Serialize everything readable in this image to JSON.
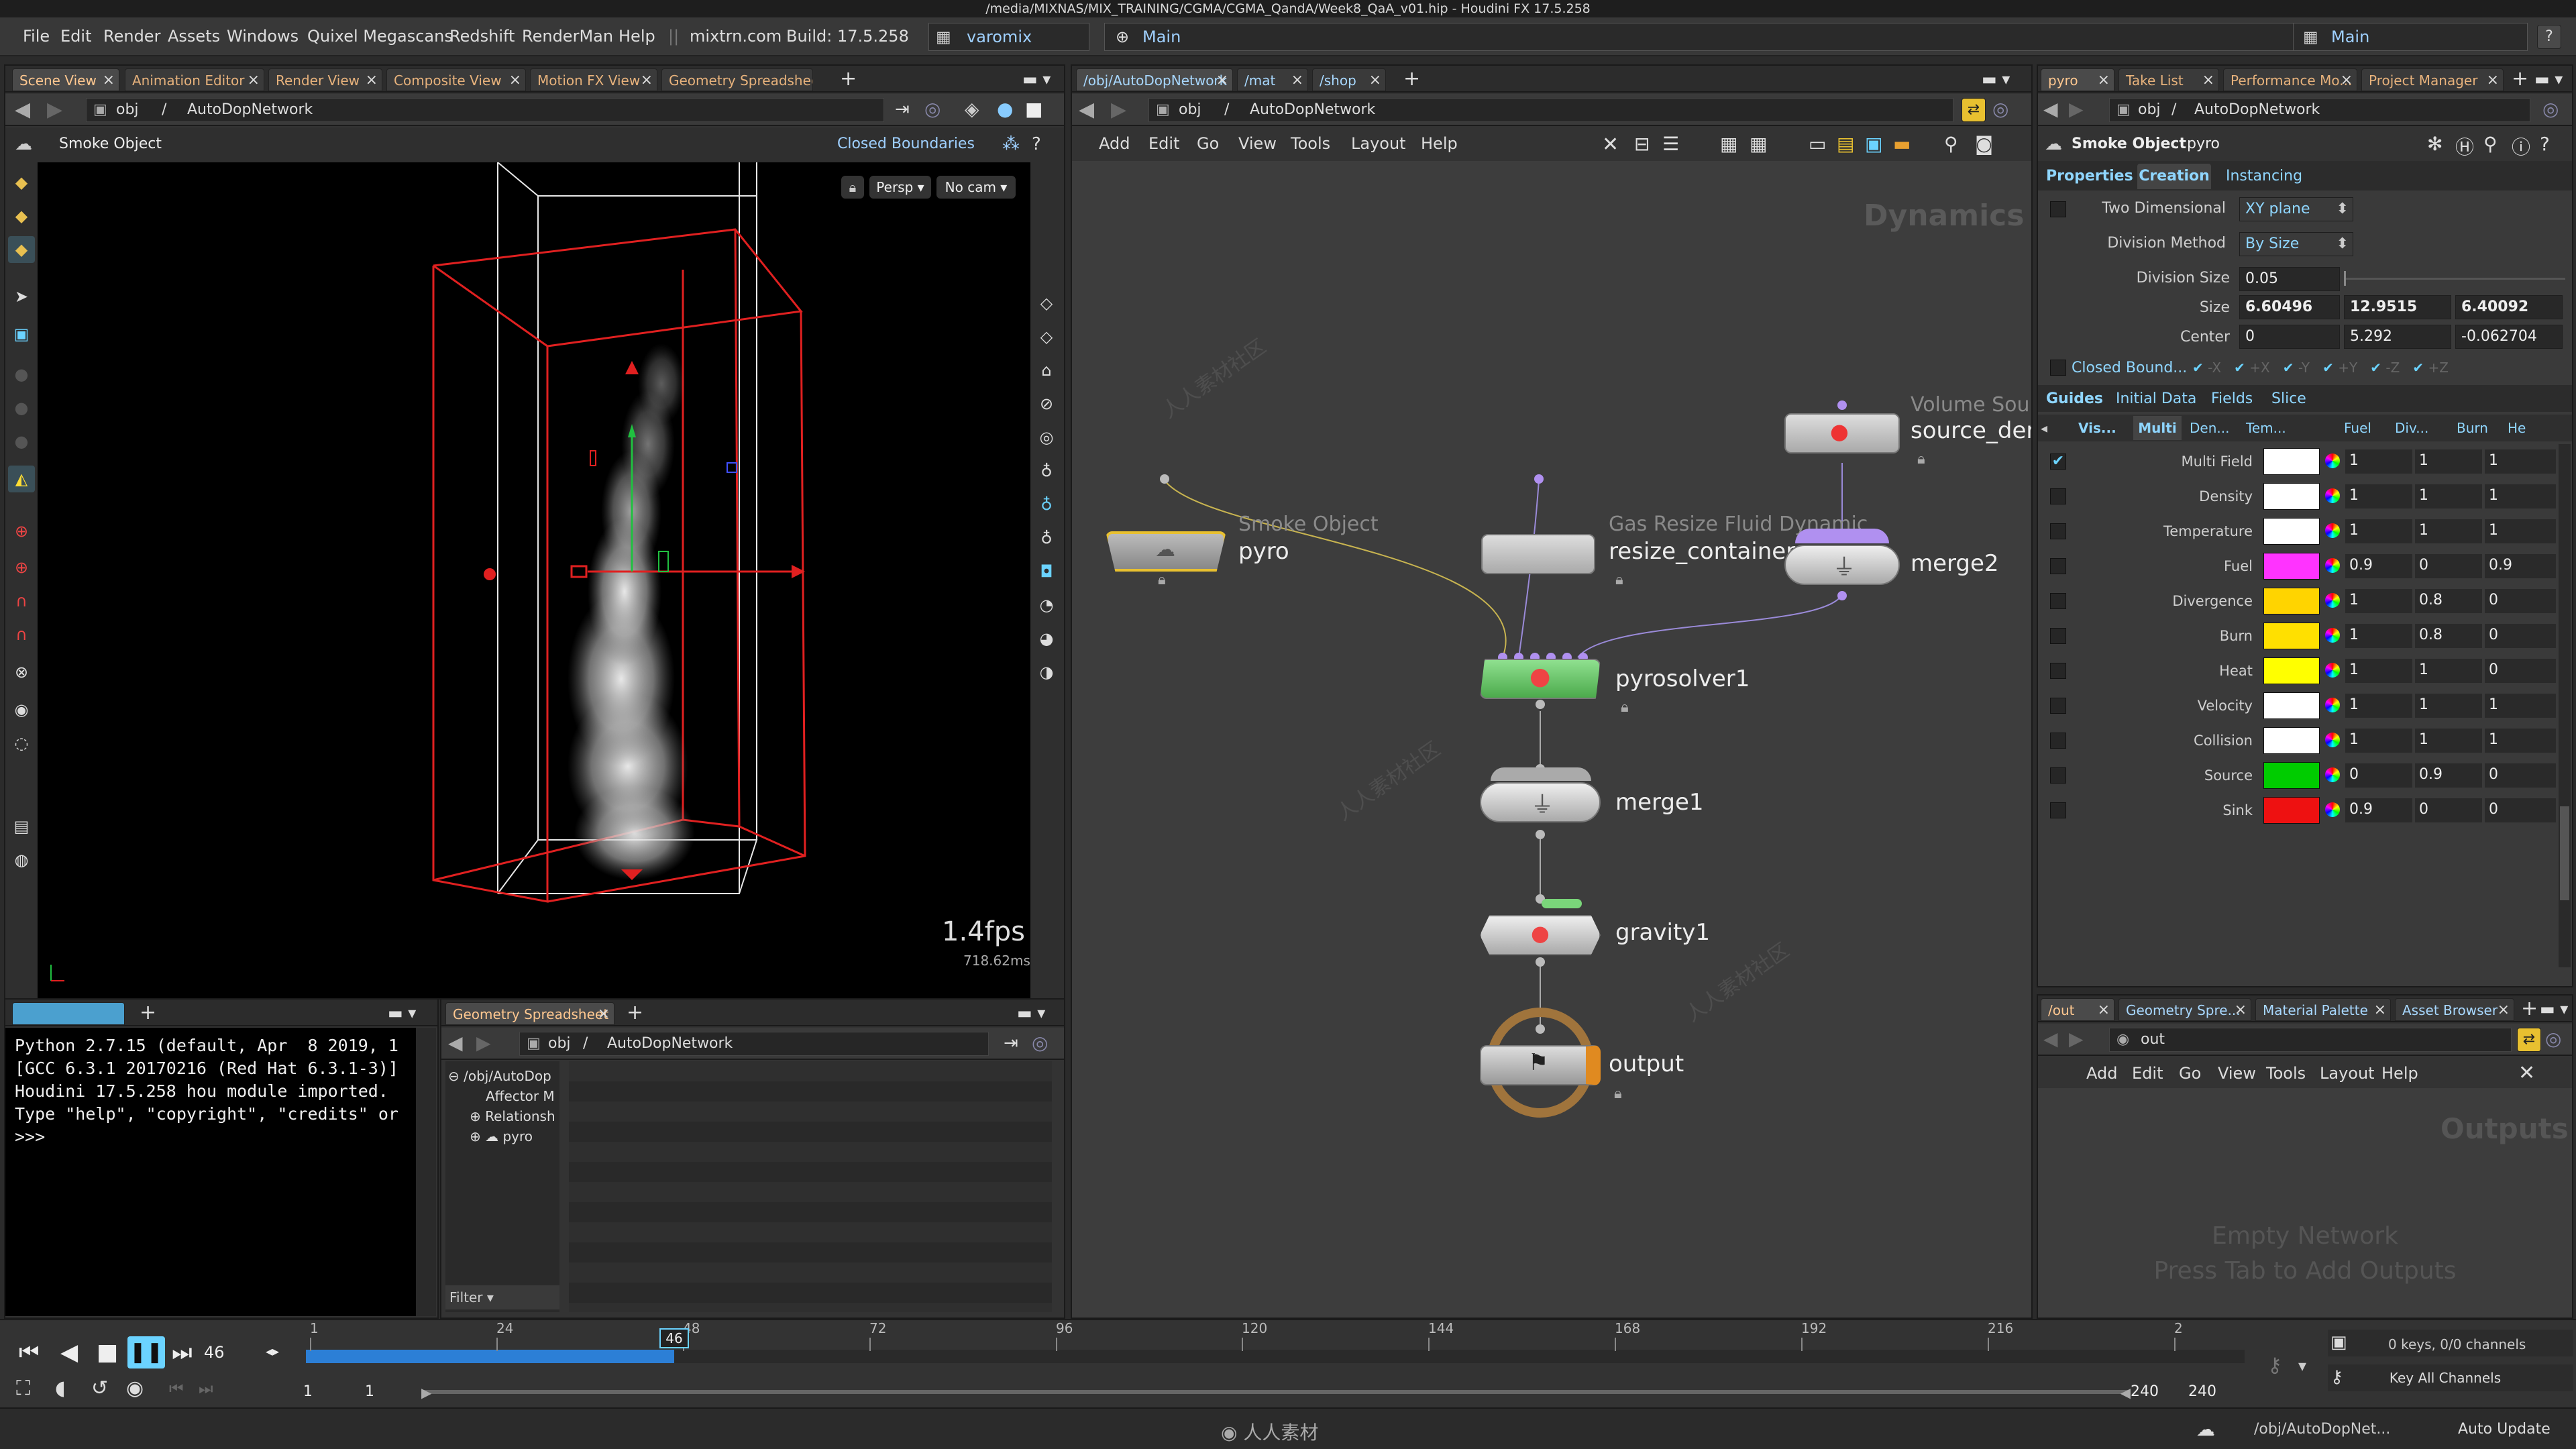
{
  "title_bar": "/media/MIXNAS/MIX_TRAINING/CGMA/CGMA_QandA/Week8_QaA_v01.hip - Houdini FX 17.5.258",
  "menu": {
    "items": [
      "File",
      "Edit",
      "Render",
      "Assets",
      "Windows",
      "Quixel Megascans",
      "Redshift",
      "RenderMan",
      "Help"
    ],
    "site": "mixtrn.com",
    "build": "Build: 17.5.258",
    "shelf_set": "varomix",
    "desktop_left": "Main",
    "desktop_right": "Main"
  },
  "scene_view": {
    "tabs": [
      "Scene View",
      "Animation Editor",
      "Render View",
      "Composite View",
      "Motion FX View",
      "Geometry Spreadsheet"
    ],
    "path_obj": "obj",
    "path_node": "AutoDopNetwork",
    "object_label": "Smoke Object",
    "closed_boundaries": "Closed Boundaries",
    "persp": "Persp",
    "nocam": "No cam",
    "fps": "1.4fps",
    "ms": "718.62ms"
  },
  "network_view": {
    "tabs": [
      "/obj/AutoDopNetwork",
      "/mat",
      "/shop"
    ],
    "path_obj": "obj",
    "path_node": "AutoDopNetwork",
    "menu": [
      "Add",
      "Edit",
      "Go",
      "View",
      "Tools",
      "Layout",
      "Help"
    ],
    "context": "Dynamics",
    "nodes": {
      "pyro": {
        "type": "Smoke Object",
        "name": "pyro"
      },
      "resize": {
        "type": "Gas Resize Fluid Dynamic",
        "name": "resize_container"
      },
      "source": {
        "type": "Volume Sou",
        "name": "source_den"
      },
      "merge2": {
        "name": "merge2"
      },
      "pyrosolver": {
        "name": "pyrosolver1"
      },
      "merge1": {
        "name": "merge1"
      },
      "gravity": {
        "name": "gravity1"
      },
      "output": {
        "name": "output"
      }
    }
  },
  "params": {
    "tabs": [
      "pyro",
      "Take List",
      "Performance Mo...",
      "Project Manager"
    ],
    "path_obj": "obj",
    "path_node": "AutoDopNetwork",
    "node_type": "Smoke Object",
    "node_name": "pyro",
    "page_tabs": [
      "Properties",
      "Creation",
      "Instancing"
    ],
    "two_dim_label": "Two Dimensional",
    "two_dim_value": "XY plane",
    "division_method_label": "Division Method",
    "division_method_value": "By Size",
    "division_size_label": "Division Size",
    "division_size_value": "0.05",
    "size_label": "Size",
    "size_values": [
      "6.60496",
      "12.9515",
      "6.40092"
    ],
    "center_label": "Center",
    "center_values": [
      "0",
      "5.292",
      "-0.062704"
    ],
    "closed_bound_label": "Closed Bound...",
    "closed_bound_flags": [
      "-X",
      "+X",
      "-Y",
      "+Y",
      "-Z",
      "+Z"
    ],
    "guide_tabs": [
      "Guides",
      "Initial Data",
      "Fields",
      "Slice"
    ],
    "guide_columns": [
      "Vis...",
      "Multi",
      "Den...",
      "Tem...",
      "Fuel",
      "Div...",
      "Burn",
      "He"
    ],
    "guide_rows": [
      {
        "name": "Multi Field",
        "color": "#ffffff",
        "v": [
          "1",
          "1",
          "1"
        ],
        "checked": true
      },
      {
        "name": "Density",
        "color": "#ffffff",
        "v": [
          "1",
          "1",
          "1"
        ],
        "checked": false
      },
      {
        "name": "Temperature",
        "color": "#ffffff",
        "v": [
          "1",
          "1",
          "1"
        ],
        "checked": false
      },
      {
        "name": "Fuel",
        "color": "#ff33ff",
        "v": [
          "0.9",
          "0",
          "0.9"
        ],
        "checked": false
      },
      {
        "name": "Divergence",
        "color": "#ffd400",
        "v": [
          "1",
          "0.8",
          "0"
        ],
        "checked": false
      },
      {
        "name": "Burn",
        "color": "#ffe000",
        "v": [
          "1",
          "0.8",
          "0"
        ],
        "checked": false
      },
      {
        "name": "Heat",
        "color": "#ffff00",
        "v": [
          "1",
          "1",
          "0"
        ],
        "checked": false
      },
      {
        "name": "Velocity",
        "color": "#ffffff",
        "v": [
          "1",
          "1",
          "1"
        ],
        "checked": false
      },
      {
        "name": "Collision",
        "color": "#ffffff",
        "v": [
          "1",
          "1",
          "1"
        ],
        "checked": false
      },
      {
        "name": "Source",
        "color": "#00cc00",
        "v": [
          "0",
          "0.9",
          "0"
        ],
        "checked": false
      },
      {
        "name": "Sink",
        "color": "#ee1111",
        "v": [
          "0.9",
          "0",
          "0"
        ],
        "checked": false
      }
    ]
  },
  "python_shell": {
    "lines": [
      "Python 2.7.15 (default, Apr  8 2019, 1",
      "[GCC 6.3.1 20170216 (Red Hat 6.3.1-3)]",
      "Houdini 17.5.258 hou module imported.",
      "Type \"help\", \"copyright\", \"credits\" or",
      ">>>"
    ]
  },
  "geo_spreadsheet": {
    "tab": "Geometry Spreadsheet",
    "path_obj": "obj",
    "path_node": "AutoDopNetwork",
    "tree": [
      "/obj/AutoDop",
      "Affector M",
      "Relationsh",
      "pyro"
    ],
    "filter": "Filter"
  },
  "out_network": {
    "tabs": [
      "/out",
      "Geometry Spre...",
      "Material Palette",
      "Asset Browser"
    ],
    "path": "out",
    "menu": [
      "Add",
      "Edit",
      "Go",
      "View",
      "Tools",
      "Layout",
      "Help"
    ],
    "context": "Outputs",
    "empty1": "Empty Network",
    "empty2": "Press Tab to Add Outputs"
  },
  "timeline": {
    "frame": "46",
    "ticks": [
      "1",
      "24",
      "48",
      "72",
      "96",
      "120",
      "144",
      "168",
      "192",
      "216",
      "2"
    ],
    "playhead": "46",
    "range_start": "1",
    "range_start2": "1",
    "range_end": "240",
    "range_end2": "240",
    "current_fraction": 0.19,
    "keys": "0 keys, 0/0 channels",
    "key_all": "Key All Channels"
  },
  "status": {
    "path": "/obj/AutoDopNet...",
    "auto_update": "Auto Update",
    "watermark": "人人素材"
  }
}
